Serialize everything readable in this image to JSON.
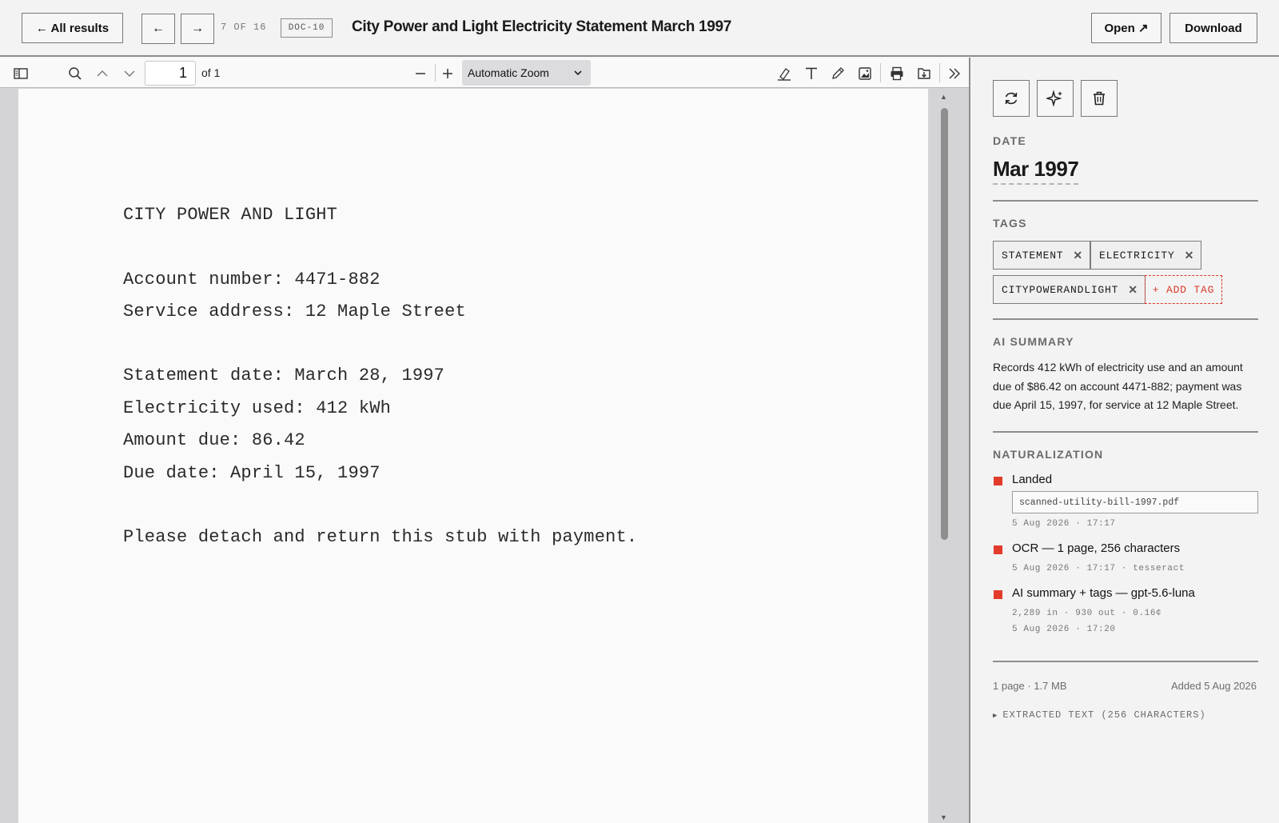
{
  "header": {
    "all_results_label": "← All results",
    "prev_label": "←",
    "next_label": "→",
    "counter": "7 OF 16",
    "doc_id": "DOC-10",
    "title": "City Power and Light Electricity Statement March 1997",
    "open_label": "Open ↗",
    "download_label": "Download"
  },
  "viewer": {
    "page_number": "1",
    "page_of": "of 1",
    "zoom": "Automatic Zoom",
    "icons": [
      "sidebar-toggle-icon",
      "search-icon",
      "chevron-up-icon",
      "chevron-down-icon",
      "minus-icon",
      "plus-icon",
      "highlight-icon",
      "text-icon",
      "draw-icon",
      "image-icon",
      "print-icon",
      "save-icon",
      "double-chevron-right-icon"
    ]
  },
  "document": {
    "lines": [
      "CITY POWER AND LIGHT",
      "Account number: 4471-882",
      "Service address: 12 Maple Street",
      "Statement date: March 28, 1997",
      "Electricity used: 412 kWh",
      "Amount due: 86.42",
      "Due date: April 15, 1997",
      "Please detach and return this stub with payment."
    ]
  },
  "panel": {
    "action_icons": [
      "refresh-icon",
      "sparkle-icon",
      "trash-icon"
    ],
    "date_label": "DATE",
    "date_value": "Mar 1997",
    "tags_label": "TAGS",
    "tags": [
      "STATEMENT",
      "ELECTRICITY",
      "CITYPOWERANDLIGHT"
    ],
    "add_tag_label": "+ ADD TAG",
    "summary_label": "AI SUMMARY",
    "summary_text": "Records 412 kWh of electricity use and an amount due of $86.42 on account 4471-882; payment was due April 15, 1997, for service at 12 Maple Street.",
    "naturalization_label": "NATURALIZATION",
    "events": [
      {
        "title": "Landed",
        "file": "scanned-utility-bill-1997.pdf",
        "meta": "5 Aug 2026 · 17:17"
      },
      {
        "title": "OCR — 1 page, 256 characters",
        "meta": "5 Aug 2026 · 17:17 · tesseract"
      },
      {
        "title": "AI summary + tags — gpt-5.6-luna",
        "meta_tokens": "2,289 in · 930 out · 0.16¢",
        "meta": "5 Aug 2026 · 17:20"
      }
    ],
    "footer_left": "1 page · 1.7 MB",
    "footer_right": "Added 5 Aug 2026",
    "extracted_label": "EXTRACTED TEXT (256 CHARACTERS)"
  },
  "colors": {
    "accent_red": "#e23b2a",
    "border_gray": "#8d8d8d",
    "panel_bg": "#f3f3f3"
  }
}
